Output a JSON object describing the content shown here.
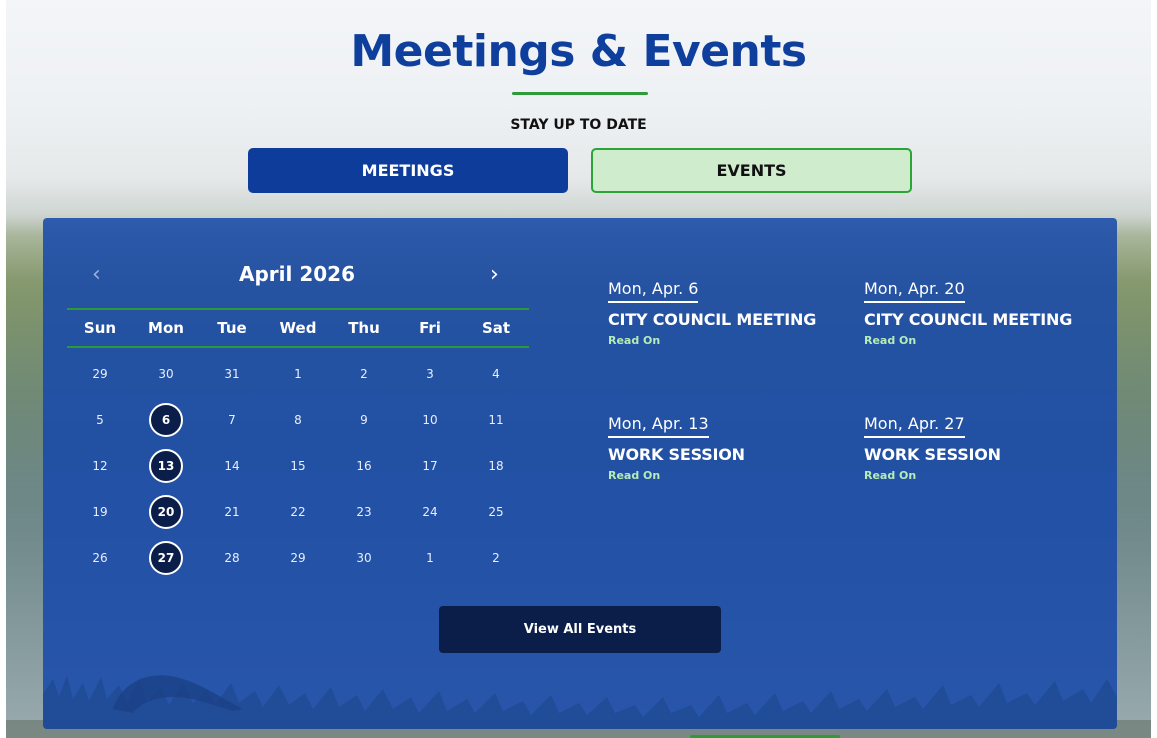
{
  "header": {
    "title": "Meetings & Events",
    "subtitle": "STAY UP TO DATE"
  },
  "tabs": [
    {
      "label": "MEETINGS",
      "active": true
    },
    {
      "label": "EVENTS",
      "active": false
    }
  ],
  "calendar": {
    "month_label": "April 2026",
    "prev_icon": "‹",
    "next_icon": "›",
    "weekdays": [
      "Sun",
      "Mon",
      "Tue",
      "Wed",
      "Thu",
      "Fri",
      "Sat"
    ],
    "weeks": [
      [
        "29",
        "30",
        "31",
        "1",
        "2",
        "3",
        "4"
      ],
      [
        "5",
        "6",
        "7",
        "8",
        "9",
        "10",
        "11"
      ],
      [
        "12",
        "13",
        "14",
        "15",
        "16",
        "17",
        "18"
      ],
      [
        "19",
        "20",
        "21",
        "22",
        "23",
        "24",
        "25"
      ],
      [
        "26",
        "27",
        "28",
        "29",
        "30",
        "1",
        "2"
      ]
    ],
    "event_days": [
      "6",
      "13",
      "20",
      "27"
    ]
  },
  "events": [
    {
      "date": "Mon, Apr. 6",
      "name": "CITY COUNCIL MEETING",
      "link": "Read On"
    },
    {
      "date": "Mon, Apr. 20",
      "name": "CITY COUNCIL MEETING",
      "link": "Read On"
    },
    {
      "date": "Mon, Apr. 13",
      "name": "WORK SESSION",
      "link": "Read On"
    },
    {
      "date": "Mon, Apr. 27",
      "name": "WORK SESSION",
      "link": "Read On"
    }
  ],
  "view_all_label": "View All Events",
  "colors": {
    "title_blue": "#0f3f9c",
    "panel_blue": "#1648aa",
    "accent_green": "#2e9a3a",
    "dark_navy": "#0b1e4a"
  }
}
